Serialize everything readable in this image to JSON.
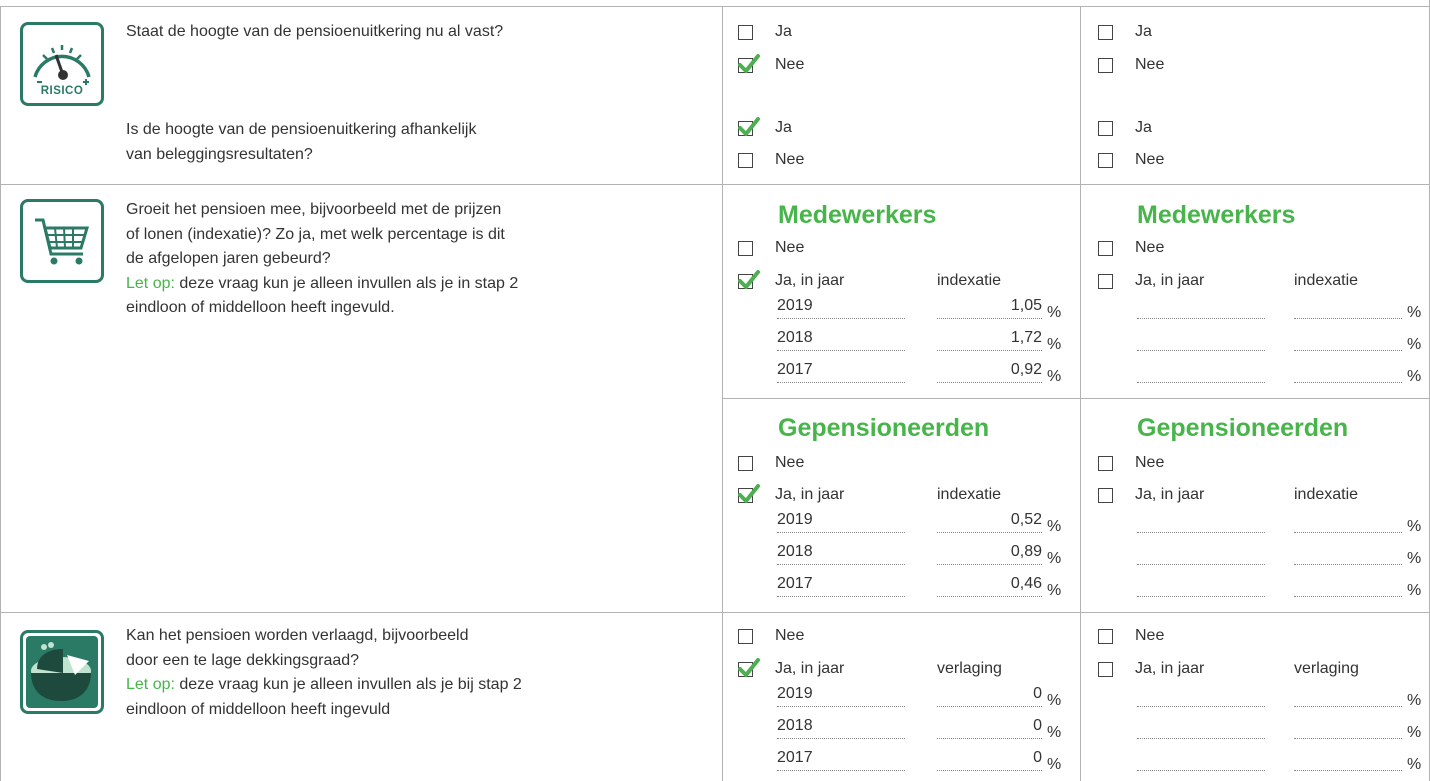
{
  "rows": {
    "risk": {
      "icon_label": "RISICO",
      "q1": "Staat de hoogte van de pensioenuitkering nu al vast?",
      "q2_line1": "Is de hoogte van de pensioenuitkering afhankelijk",
      "q2_line2": "van beleggingsresultaten?"
    },
    "indexation": {
      "line1": "Groeit het pensioen mee, bijvoorbeeld met de prijzen",
      "line2": "of lonen (indexatie)? Zo ja, met welk percentage is dit",
      "line3": "de afgelopen jaren gebeurd?",
      "note": "Let op:",
      "line4": " deze vraag kun je alleen invullen als je in stap 2",
      "line5": "eindloon of middelloon heeft ingevuld."
    },
    "reduction": {
      "line1": "Kan het pensioen worden verlaagd, bijvoorbeeld",
      "line2": "door een te lage dekkingsgraad?",
      "note": "Let op:",
      "line3": " deze vraag kun je alleen invullen als je bij stap 2",
      "line4": "eindloon of middelloon heeft ingevuld"
    }
  },
  "labels": {
    "ja": "Ja",
    "nee": "Nee",
    "ja_in_jaar": "Ja, in jaar",
    "indexatie": "indexatie",
    "verlaging": "verlaging",
    "medewerkers": "Medewerkers",
    "gepensioneerden": "Gepensioneerden",
    "percent": "%"
  },
  "col1": {
    "vast": {
      "ja": false,
      "nee": true
    },
    "beleggingen": {
      "ja": true,
      "nee": false
    },
    "medewerkers": {
      "nee": false,
      "ja": true,
      "rows": [
        {
          "year": "2019",
          "value": "1,05"
        },
        {
          "year": "2018",
          "value": "1,72"
        },
        {
          "year": "2017",
          "value": "0,92"
        }
      ]
    },
    "gepensioneerden": {
      "nee": false,
      "ja": true,
      "rows": [
        {
          "year": "2019",
          "value": "0,52"
        },
        {
          "year": "2018",
          "value": "0,89"
        },
        {
          "year": "2017",
          "value": "0,46"
        }
      ]
    },
    "verlaging": {
      "nee": false,
      "ja": true,
      "rows": [
        {
          "year": "2019",
          "value": "0"
        },
        {
          "year": "2018",
          "value": "0"
        },
        {
          "year": "2017",
          "value": "0"
        }
      ]
    }
  },
  "colors": {
    "accent_green": "#47b54a",
    "icon_teal": "#2b7a66",
    "check_green": "#4caf50"
  }
}
